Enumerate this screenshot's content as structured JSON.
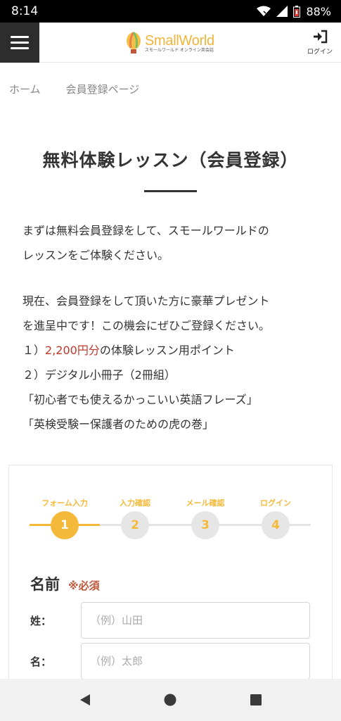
{
  "status": {
    "time": "8:14",
    "battery": "88%"
  },
  "header": {
    "logo_name": "SmallWorld",
    "logo_sub": "スモールワールド オンライン英会話",
    "login_label": "ログイン"
  },
  "breadcrumb": {
    "home": "ホーム",
    "current": "会員登録ページ"
  },
  "page": {
    "title": "無料体験レッスン（会員登録）"
  },
  "intro": {
    "line1": "まずは無料会員登録をして、スモールワールドの",
    "line2": "レッスンをご体験ください。",
    "line3": "現在、会員登録をして頂いた方に豪華プレゼント",
    "line4": "を進呈中です！この機会にぜひご登録ください。",
    "item1_prefix": "１）",
    "item1_accent": "2,200円分",
    "item1_suffix": "の体験レッスン用ポイント",
    "item2": "２）デジタル小冊子（2冊組）",
    "item3": "「初心者でも使えるかっこいい英語フレーズ」",
    "item4": "「英検受験ー保護者のための虎の巻」"
  },
  "steps": [
    {
      "label": "フォーム入力",
      "num": "1"
    },
    {
      "label": "入力確認",
      "num": "2"
    },
    {
      "label": "メール確認",
      "num": "3"
    },
    {
      "label": "ログイン",
      "num": "4"
    }
  ],
  "form": {
    "section_name": "名前",
    "required": "※必須",
    "last_name_label": "姓：",
    "last_name_placeholder": "（例）山田",
    "first_name_label": "名：",
    "first_name_placeholder": "（例）太郎"
  },
  "colors": {
    "accent": "#f5b93a",
    "required": "#c0573a",
    "menu_bg": "#2d2d2d"
  },
  "icons": [
    "wifi-icon",
    "signal-icon",
    "battery-icon",
    "hamburger-icon",
    "login-icon",
    "back-icon",
    "home-icon",
    "recents-icon"
  ]
}
